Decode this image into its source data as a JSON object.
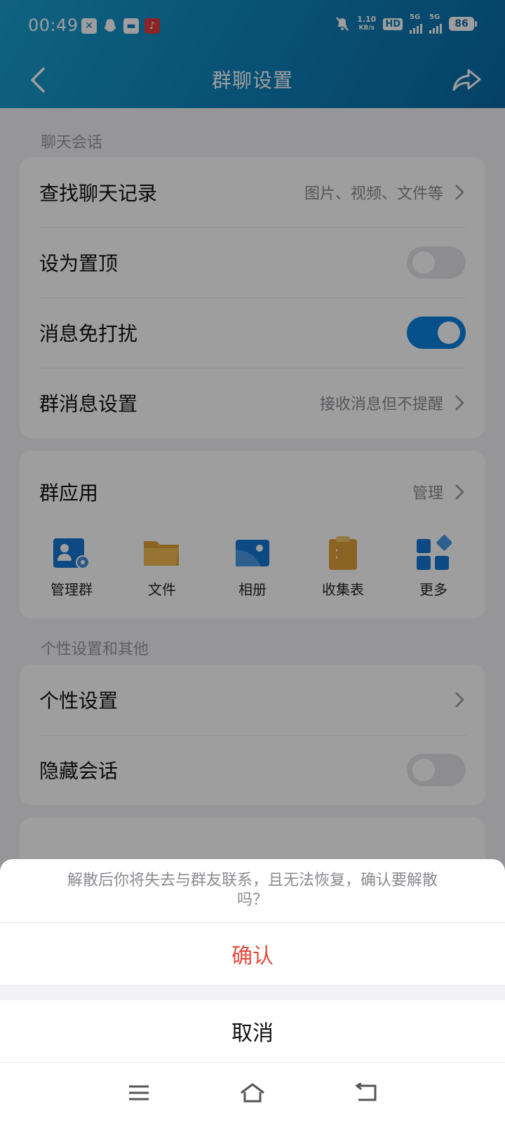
{
  "status_bar": {
    "time": "00:49",
    "net_speed_value": "1.10",
    "net_speed_unit": "KB/s",
    "hd_label": "HD",
    "sim1_label": "5G",
    "sim2_label": "5G",
    "battery": "86"
  },
  "header": {
    "title": "群聊设置"
  },
  "sections": {
    "chat_section_title": "聊天会话",
    "personal_section_title": "个性设置和其他"
  },
  "chat_rows": {
    "search_history": {
      "label": "查找聊天记录",
      "value": "图片、视频、文件等"
    },
    "pin_top": {
      "label": "设为置顶",
      "toggle": "off"
    },
    "do_not_disturb": {
      "label": "消息免打扰",
      "toggle": "on"
    },
    "group_msg_settings": {
      "label": "群消息设置",
      "value": "接收消息但不提醒"
    }
  },
  "group_apps": {
    "title": "群应用",
    "manage_label": "管理",
    "items": [
      {
        "label": "管理群",
        "icon": "manage-group-icon"
      },
      {
        "label": "文件",
        "icon": "folder-icon"
      },
      {
        "label": "相册",
        "icon": "album-icon"
      },
      {
        "label": "收集表",
        "icon": "clipboard-icon"
      },
      {
        "label": "更多",
        "icon": "more-apps-icon"
      }
    ]
  },
  "personal_rows": {
    "personal_settings": {
      "label": "个性设置"
    },
    "hide_chat": {
      "label": "隐藏会话",
      "toggle": "off"
    }
  },
  "action_sheet": {
    "message": "解散后你将失去与群友联系，且无法恢复，确认要解散吗？",
    "confirm_label": "确认",
    "cancel_label": "取消"
  },
  "colors": {
    "header_blue": "#0f86bf",
    "toggle_on": "#0a84e0",
    "danger": "#e5493a"
  }
}
